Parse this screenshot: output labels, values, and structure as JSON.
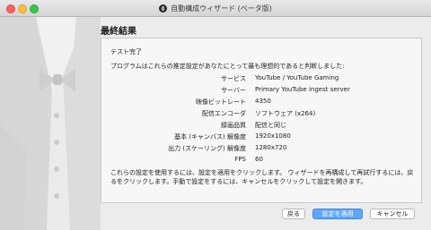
{
  "window": {
    "title": "自動構成ウィザード (ベータ版)"
  },
  "page": {
    "heading": "最終結果",
    "status": "テスト完了",
    "intro": "プログラムはこれらの推定設定があなたにとって最も理想的であると判断しました:",
    "rows": [
      {
        "label": "サービス",
        "value": "YouTube / YouTube Gaming"
      },
      {
        "label": "サーバー",
        "value": "Primary YouTube ingest server"
      },
      {
        "label": "映像ビットレート",
        "value": "4350"
      },
      {
        "label": "配信エンコーダ",
        "value": "ソフトウェア (x264)"
      },
      {
        "label": "録画品質",
        "value": "配信と同じ"
      },
      {
        "label": "基本 (キャンバス) 解像度",
        "value": "1920x1080"
      },
      {
        "label": "出力 (スケーリング) 解像度",
        "value": "1280x720"
      },
      {
        "label": "FPS",
        "value": "60"
      }
    ],
    "footer": "これらの設定を使用するには、設定を適用をクリックします。 ウィザードを再構成して再試行するには、戻るをクリックします。手動で設定をするには、キャンセルをクリックして設定を開きます。"
  },
  "buttons": {
    "back": "戻る",
    "apply": "設定を適用",
    "cancel": "キャンセル"
  },
  "colors": {
    "accent": "#5fa6f7",
    "close": "#fc605c",
    "minimize": "#fdbc40",
    "maximize": "#34c84a"
  }
}
